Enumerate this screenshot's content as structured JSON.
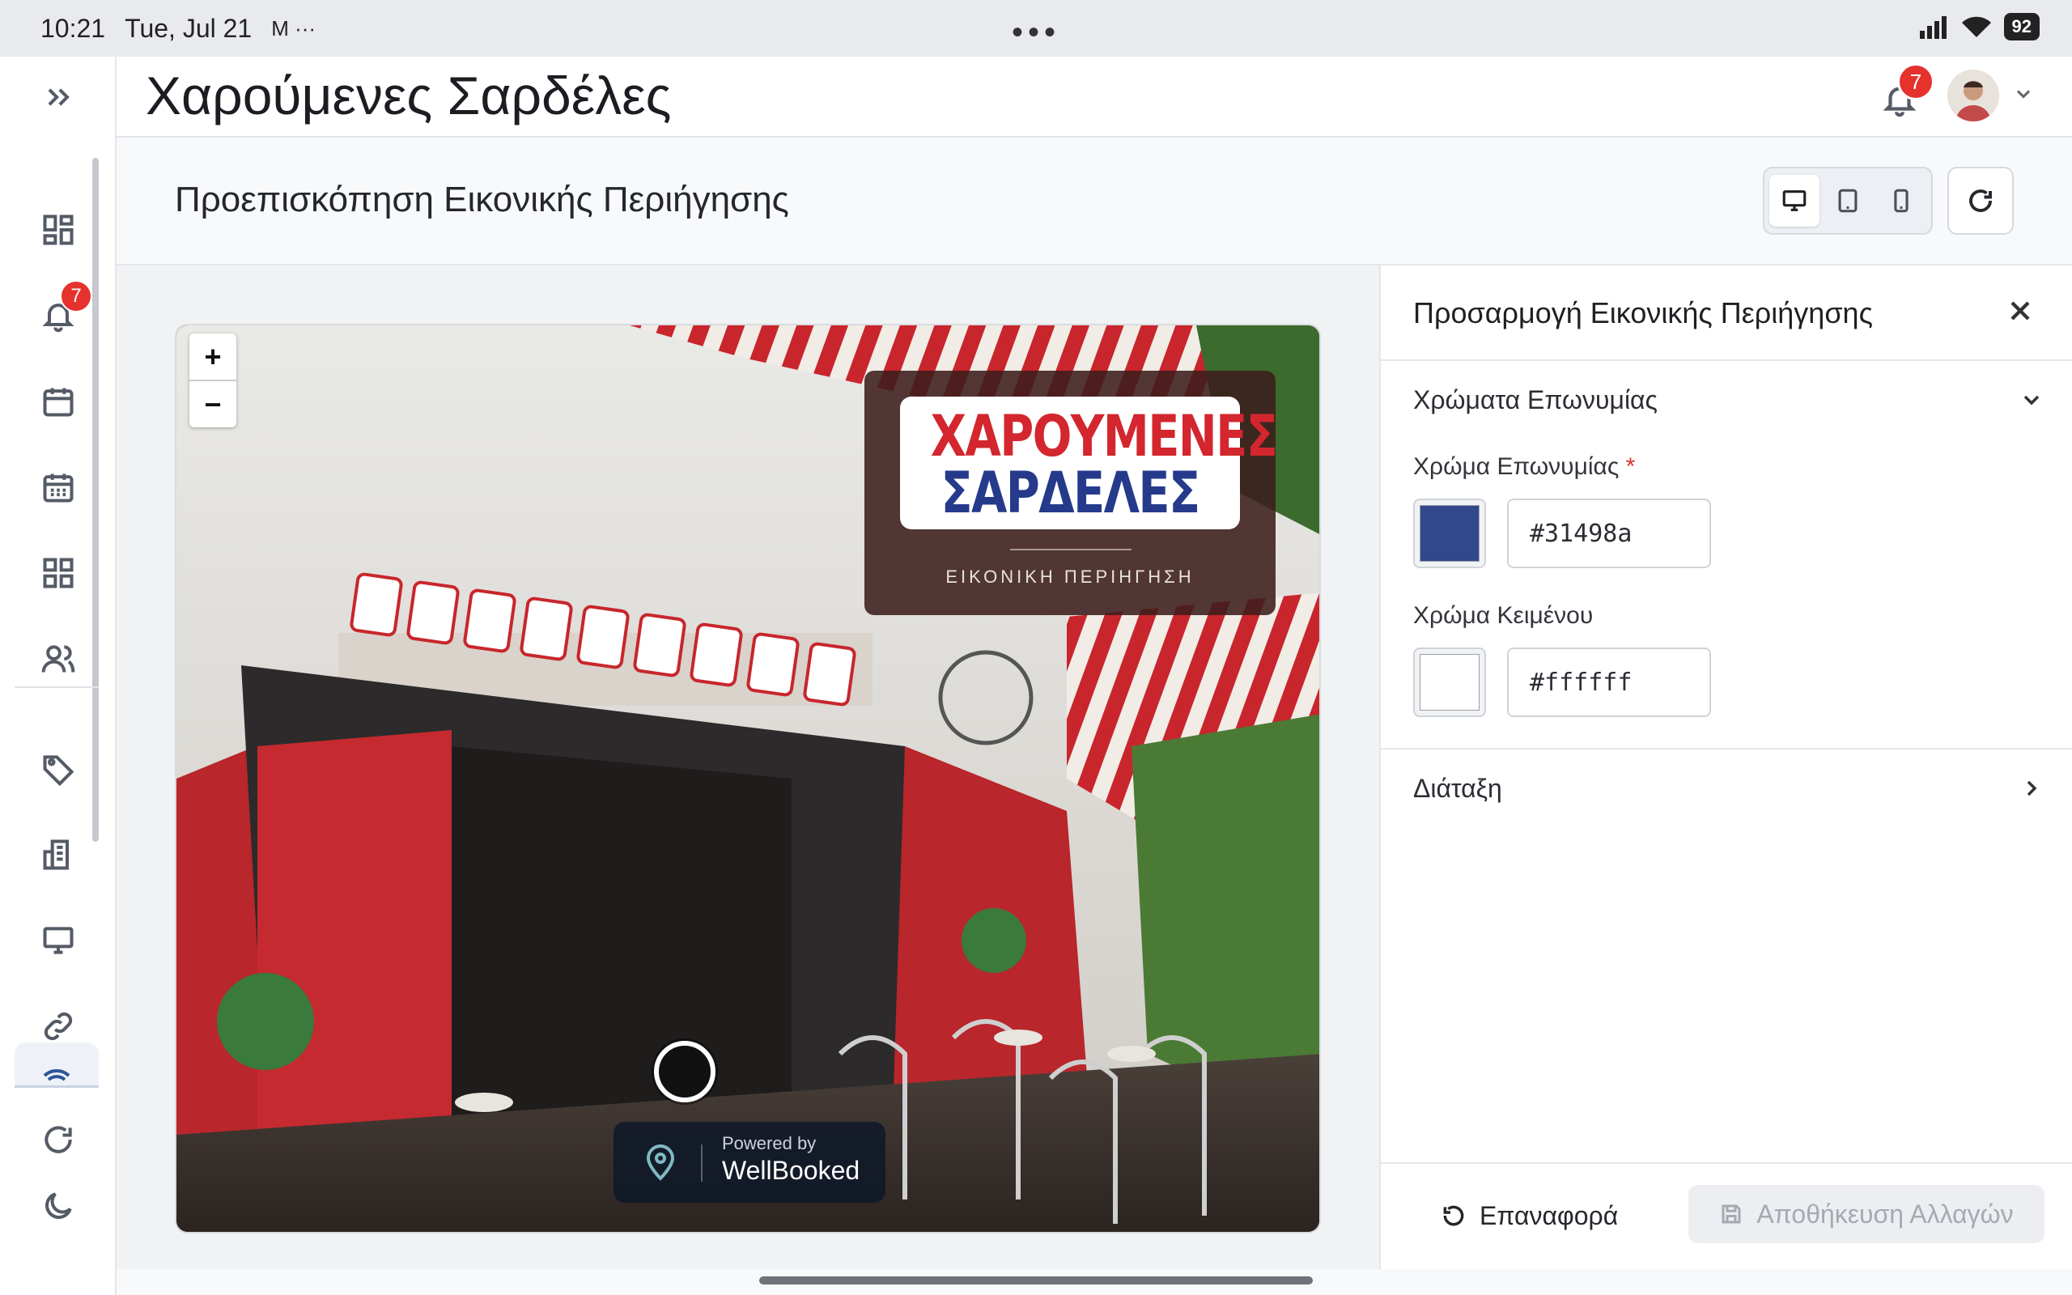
{
  "status_bar": {
    "time": "10:21",
    "date": "Tue, Jul 21",
    "app_icons": "M ···",
    "center_dots": "•••",
    "battery": "92"
  },
  "sidebar": {
    "notification_badge": "7",
    "items": [
      {
        "icon": "expand-icon"
      },
      {
        "icon": "dashboard-icon"
      },
      {
        "icon": "bell-icon"
      },
      {
        "icon": "calendar-icon"
      },
      {
        "icon": "calendar-grid-icon"
      },
      {
        "icon": "apps-icon"
      },
      {
        "icon": "users-icon"
      },
      {
        "icon": "tag-icon"
      },
      {
        "icon": "building-icon"
      },
      {
        "icon": "monitor-icon"
      },
      {
        "icon": "link-icon"
      },
      {
        "icon": "wifi-icon"
      },
      {
        "icon": "refresh-icon"
      },
      {
        "icon": "moon-icon"
      }
    ]
  },
  "header": {
    "title": "Χαρούμενες Σαρδέλες",
    "notification_count": "7"
  },
  "subheader": {
    "title": "Προεπισκόπηση Εικονικής Περιήγησης",
    "active_device": "desktop"
  },
  "preview": {
    "zoom_in": "+",
    "zoom_out": "−",
    "logo_line1": "ΧΑΡΟΥΜΕΝΕΣ",
    "logo_line2": "ΣΑΡΔΕΛΕΣ",
    "card_subtitle": "ΕΙΚΟΝΙΚΗ ΠΕΡΙΗΓΗΣΗ",
    "powered_small": "Powered by",
    "powered_brand": "WellBooked",
    "colors": {
      "card_bg": "#3c1e1c",
      "logo_red": "#d3262e",
      "logo_blue": "#263a8c"
    }
  },
  "panel": {
    "title": "Προσαρμογή Εικονικής Περιήγησης",
    "section_colors": "Χρώματα Επωνυμίας",
    "brand_color_label": "Χρώμα Επωνυμίας",
    "required_mark": "*",
    "brand_color_value": "#31498a",
    "text_color_label": "Χρώμα Κειμένου",
    "text_color_value": "#ffffff",
    "section_layout": "Διάταξη",
    "reset_label": "Επαναφορά",
    "save_label": "Αποθήκευση Αλλαγών"
  }
}
